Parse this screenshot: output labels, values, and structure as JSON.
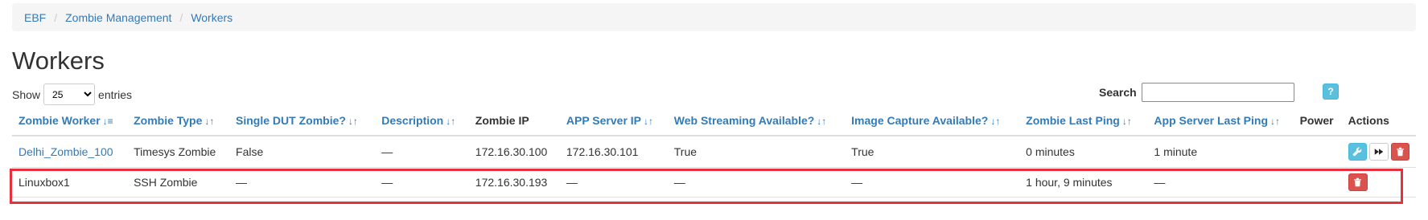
{
  "breadcrumb": [
    "EBF",
    "Zombie Management",
    "Workers"
  ],
  "page_title": "Workers",
  "length_menu": {
    "prefix": "Show",
    "selected": "25",
    "suffix": "entries"
  },
  "search": {
    "label": "Search",
    "value": ""
  },
  "help_label": "?",
  "columns": [
    {
      "label": "Zombie Worker",
      "sortable": true,
      "sort": "asc"
    },
    {
      "label": "Zombie Type",
      "sortable": true
    },
    {
      "label": "Single DUT Zombie?",
      "sortable": true
    },
    {
      "label": "Description",
      "sortable": true
    },
    {
      "label": "Zombie IP",
      "sortable": false
    },
    {
      "label": "APP Server IP",
      "sortable": true
    },
    {
      "label": "Web Streaming Available?",
      "sortable": true
    },
    {
      "label": "Image Capture Available?",
      "sortable": true
    },
    {
      "label": "Zombie Last Ping",
      "sortable": true
    },
    {
      "label": "App Server Last Ping",
      "sortable": true
    },
    {
      "label": "Power",
      "sortable": false
    },
    {
      "label": "Actions",
      "sortable": false
    }
  ],
  "rows": [
    {
      "worker": "Delhi_Zombie_100",
      "type": "Timesys Zombie",
      "single_dut": "False",
      "description": "—",
      "zombie_ip": "172.16.30.100",
      "app_server_ip": "172.16.30.101",
      "web_streaming": "True",
      "image_capture": "True",
      "zombie_last_ping": "0 minutes",
      "app_server_last_ping": "1 minute",
      "power": ""
    },
    {
      "worker": "Linuxbox1",
      "type": "SSH Zombie",
      "single_dut": "—",
      "description": "—",
      "zombie_ip": "172.16.30.193",
      "app_server_ip": "—",
      "web_streaming": "—",
      "image_capture": "—",
      "zombie_last_ping": "1 hour, 9 minutes",
      "app_server_last_ping": "—",
      "power": ""
    }
  ],
  "icons": {
    "sort_asc": "↓≡",
    "sort_both": "↓↑",
    "edit": "wrench-icon",
    "fast_forward": "fast-forward-icon",
    "delete": "trash-icon"
  },
  "colors": {
    "link": "#337ab7",
    "info": "#5bc0de",
    "danger": "#d9534f",
    "highlight": "#e8303a"
  }
}
